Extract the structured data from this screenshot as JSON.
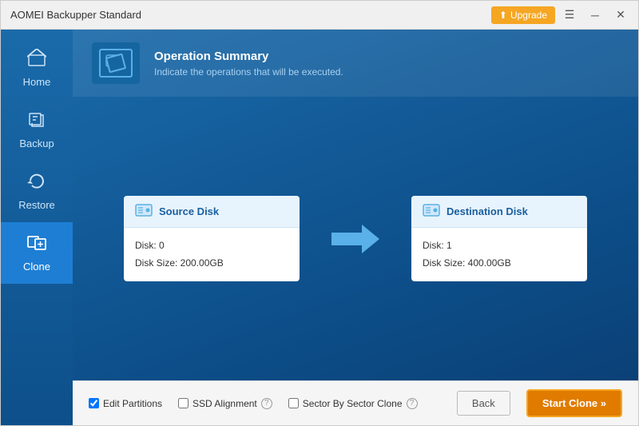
{
  "titlebar": {
    "title": "AOMEI Backupper Standard",
    "upgrade_label": "Upgrade",
    "menu_icon": "☰",
    "minimize_icon": "─",
    "close_icon": "✕"
  },
  "sidebar": {
    "items": [
      {
        "id": "home",
        "label": "Home",
        "icon": "🏠",
        "active": false
      },
      {
        "id": "backup",
        "label": "Backup",
        "icon": "💾",
        "active": false
      },
      {
        "id": "restore",
        "label": "Restore",
        "icon": "🔄",
        "active": false
      },
      {
        "id": "clone",
        "label": "Clone",
        "icon": "📋",
        "active": true
      }
    ]
  },
  "operation_summary": {
    "title": "Operation Summary",
    "description": "Indicate the operations that will be executed."
  },
  "source_disk": {
    "header": "Source Disk",
    "disk_number": "Disk: 0",
    "disk_size": "Disk Size: 200.00GB"
  },
  "destination_disk": {
    "header": "Destination Disk",
    "disk_number": "Disk: 1",
    "disk_size": "Disk Size: 400.00GB"
  },
  "bottom_bar": {
    "edit_partitions_label": "Edit Partitions",
    "ssd_alignment_label": "SSD Alignment",
    "sector_by_sector_label": "Sector By Sector Clone",
    "back_label": "Back",
    "start_clone_label": "Start Clone »"
  }
}
